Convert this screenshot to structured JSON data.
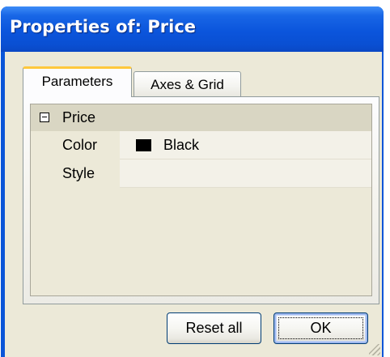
{
  "window": {
    "title": "Properties of: Price"
  },
  "tabs": [
    {
      "label": "Parameters",
      "selected": true
    },
    {
      "label": "Axes & Grid",
      "selected": false
    }
  ],
  "property_grid": {
    "category": {
      "label": "Price",
      "expanded": true
    },
    "properties": [
      {
        "name": "Color",
        "value": "Black",
        "swatch_color": "#000000"
      },
      {
        "name": "Style",
        "value": ""
      }
    ]
  },
  "buttons": {
    "reset_label": "Reset all",
    "ok_label": "OK"
  },
  "colors": {
    "titlebar": "#0a55d8",
    "dialog_bg": "#ece9d8",
    "tab_highlight": "#ffc83c"
  }
}
